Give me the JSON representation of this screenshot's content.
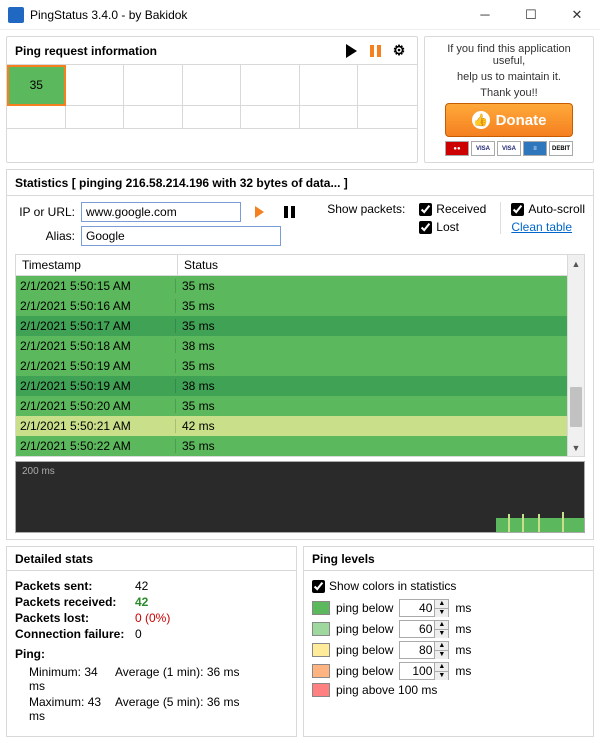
{
  "title": "PingStatus 3.4.0 - by Bakidok",
  "panels": {
    "pingreq": {
      "title": "Ping request information",
      "current": "35"
    },
    "donate": {
      "l1": "If you find this application useful,",
      "l2": "help us to maintain it.",
      "l3": "Thank you!!",
      "btn": "Donate"
    }
  },
  "stats": {
    "title": "Statistics  [ pinging 216.58.214.196 with 32 bytes of data... ]",
    "ip_label": "IP or URL:",
    "ip_value": "www.google.com",
    "alias_label": "Alias:",
    "alias_value": "Google",
    "showpackets": "Show packets:",
    "received": "Received",
    "lost": "Lost",
    "autoscroll": "Auto-scroll",
    "cleantable": "Clean table",
    "col_ts": "Timestamp",
    "col_st": "Status",
    "rows": [
      {
        "ts": "2/1/2021  5:50:15 AM",
        "st": "35 ms",
        "cls": "g-med"
      },
      {
        "ts": "2/1/2021  5:50:16 AM",
        "st": "35 ms",
        "cls": "g-med"
      },
      {
        "ts": "2/1/2021  5:50:17 AM",
        "st": "35 ms",
        "cls": "g-dark"
      },
      {
        "ts": "2/1/2021  5:50:18 AM",
        "st": "38 ms",
        "cls": "g-med"
      },
      {
        "ts": "2/1/2021  5:50:19 AM",
        "st": "35 ms",
        "cls": "g-med"
      },
      {
        "ts": "2/1/2021  5:50:19 AM",
        "st": "38 ms",
        "cls": "g-dark"
      },
      {
        "ts": "2/1/2021  5:50:20 AM",
        "st": "35 ms",
        "cls": "g-med"
      },
      {
        "ts": "2/1/2021  5:50:21 AM",
        "st": "42 ms",
        "cls": "g-yel"
      },
      {
        "ts": "2/1/2021  5:50:22 AM",
        "st": "35 ms",
        "cls": "g-med"
      }
    ],
    "graph_label": "200 ms"
  },
  "detailed": {
    "title": "Detailed stats",
    "sent_k": "Packets sent:",
    "sent_v": "42",
    "recv_k": "Packets received:",
    "recv_v": "42",
    "lost_k": "Packets lost:",
    "lost_v": "0  (0%)",
    "fail_k": "Connection failure:",
    "fail_v": "0",
    "ping_h": "Ping:",
    "min_k": "Minimum:",
    "min_v": "34 ms",
    "max_k": "Maximum:",
    "max_v": "43 ms",
    "avg1_k": "Average (1 min):",
    "avg1_v": "36 ms",
    "avg5_k": "Average (5 min):",
    "avg5_v": "36 ms"
  },
  "levels": {
    "title": "Ping levels",
    "showcolors": "Show colors in statistics",
    "below": "ping below",
    "above": "ping above 100 ms",
    "ms": "ms",
    "v1": "40",
    "v2": "60",
    "v3": "80",
    "v4": "100"
  }
}
